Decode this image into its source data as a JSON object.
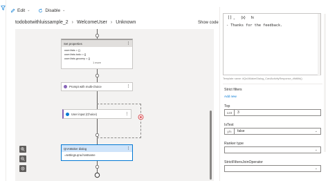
{
  "toolbar": {
    "edit_label": "Edit",
    "disable_label": "Disable"
  },
  "breadcrumb": [
    "todobotwithluissample_2",
    "WelcomeUser",
    "Unknown"
  ],
  "show_code_label": "Show code",
  "canvas": {
    "set_properties": {
      "title": "Set properties",
      "lines": [
        "user.lists = {}",
        "user.lists.todo = []",
        "user.lists.grocery = []"
      ],
      "more": "1 more"
    },
    "prompt": {
      "title": "Prompt with multi-choice"
    },
    "user_input": {
      "title": "User input (Choice)"
    },
    "qna": {
      "title": "QnAMaker dialog",
      "body": "=settings.qna.hostname"
    }
  },
  "editor": {
    "tools": [
      "{x}",
      "fx"
    ],
    "line": "- Thanks for the feedback."
  },
  "template_name": "Template name: #QnAMakerDialog_CardActivityResponse_dfdt6fd()",
  "right_panel": {
    "strict_filters_label": "Strict filters",
    "add_new_label": "Add new",
    "top_label": "Top",
    "top_badge": "123",
    "top_value": "3",
    "istest_label": "IsTest",
    "istest_badge": "y/n",
    "istest_value": "false",
    "ranker_label": "Ranker type",
    "strict_join_label": "StrictFiltersJoinOperator"
  },
  "colors": {
    "accent": "#0078d4",
    "prompt_purple": "#8764b8",
    "error_red": "#d13438"
  }
}
